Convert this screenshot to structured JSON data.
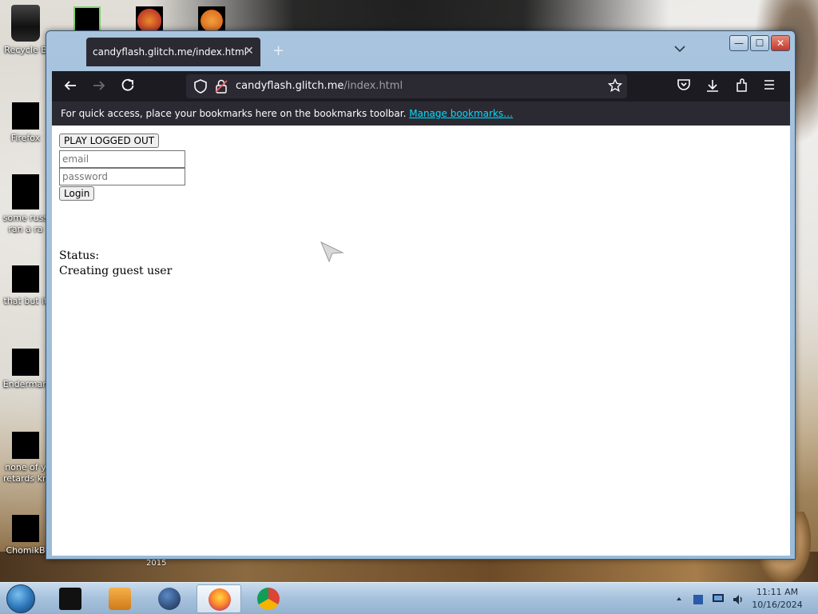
{
  "desktop": {
    "icons": [
      {
        "label": "Recycle B"
      },
      {
        "label": "Firefox"
      },
      {
        "label": "some russ ran a ra"
      },
      {
        "label": "that but it"
      },
      {
        "label": "Enderman"
      },
      {
        "label": "none of y retards kn"
      },
      {
        "label": "ChomikB"
      }
    ],
    "wallpaper_year": "2015"
  },
  "browser": {
    "tab_title": "candyflash.glitch.me/index.html",
    "tab_close": "✕",
    "new_tab": "+",
    "url_host": "candyflash.glitch.me",
    "url_path": "/index.html",
    "bookmarks_message": "For quick access, place your bookmarks here on the bookmarks toolbar.",
    "bookmarks_link": "Manage bookmarks…",
    "window_controls": {
      "minimize": "—",
      "maximize": "☐",
      "close": "✕"
    }
  },
  "page": {
    "play_logged_out_label": "PLAY LOGGED OUT",
    "email_placeholder": "email",
    "password_placeholder": "password",
    "login_label": "Login",
    "status_label": "Status:",
    "status_value": "Creating guest user"
  },
  "taskbar": {
    "time": "11:11 AM",
    "date": "10/16/2024"
  },
  "colors": {
    "accent_link": "#00ddff",
    "toolbar_dark": "#1c1b22",
    "tab_dark": "#2b2a33",
    "window_frame": "#a8c4de"
  }
}
